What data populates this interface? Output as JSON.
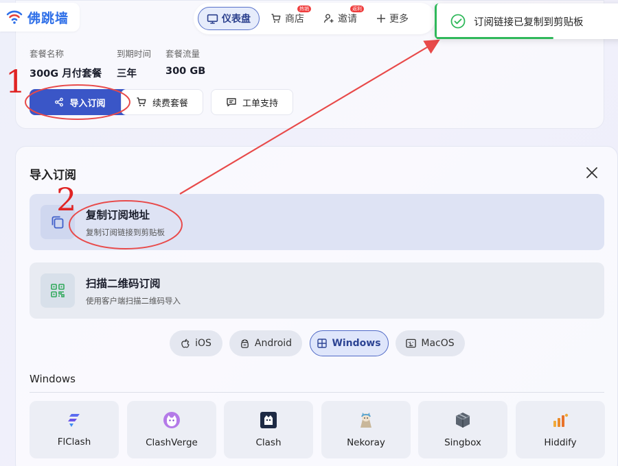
{
  "logo": {
    "text": "佛跳墙"
  },
  "nav": {
    "items": [
      {
        "label": "仪表盘",
        "icon": "monitor-icon",
        "active": true
      },
      {
        "label": "商店",
        "icon": "cart-icon",
        "badge": "热销"
      },
      {
        "label": "邀请",
        "icon": "user-plus-icon",
        "badge": "返利"
      },
      {
        "label": "更多",
        "icon": "plus-icon"
      }
    ]
  },
  "toast": {
    "text": "订阅链接已复制到剪贴板",
    "color": "#2fb85a"
  },
  "subscription": {
    "plan_label": "套餐名称",
    "plan_value": "300G 月付套餐",
    "expiry_label": "到期时间",
    "expiry_value": "三年",
    "traffic_label": "套餐流量",
    "traffic_value": "300 GB",
    "buttons": {
      "import": "导入订阅",
      "renew": "续费套餐",
      "ticket": "工单支持"
    }
  },
  "import_panel": {
    "title": "导入订阅",
    "options": [
      {
        "title": "复制订阅地址",
        "subtitle": "复制订阅链接到剪贴板",
        "icon": "copy-icon"
      },
      {
        "title": "扫描二维码订阅",
        "subtitle": "使用客户端扫描二维码导入",
        "icon": "qrcode-icon"
      }
    ],
    "os_tabs": [
      {
        "label": "iOS",
        "icon": "apple-icon"
      },
      {
        "label": "Android",
        "icon": "android-icon"
      },
      {
        "label": "Windows",
        "icon": "windows-icon",
        "active": true
      },
      {
        "label": "MacOS",
        "icon": "macos-icon"
      }
    ],
    "section_title": "Windows",
    "clients": [
      {
        "label": "FlClash",
        "icon": "flclash-icon"
      },
      {
        "label": "ClashVerge",
        "icon": "clashverge-icon"
      },
      {
        "label": "Clash",
        "icon": "clash-icon"
      },
      {
        "label": "Nekoray",
        "icon": "nekoray-icon"
      },
      {
        "label": "Singbox",
        "icon": "singbox-icon"
      },
      {
        "label": "Hiddify",
        "icon": "hiddify-icon"
      }
    ]
  },
  "annotations": {
    "step1": "1",
    "step2": "2",
    "color": "#e02424"
  }
}
